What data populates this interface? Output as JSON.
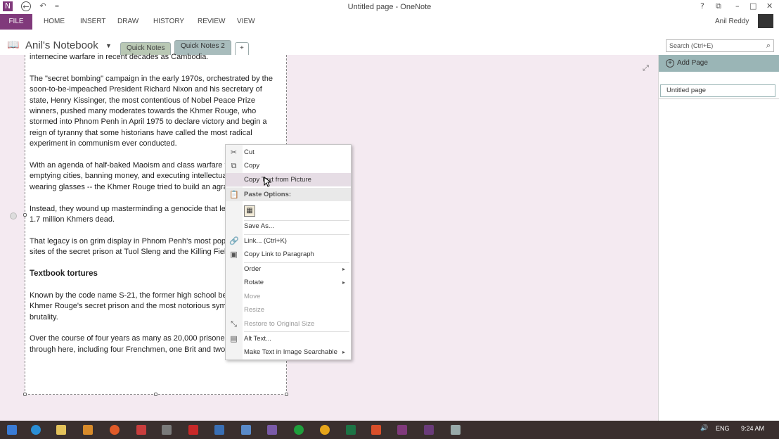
{
  "window": {
    "title": "Untitled page - OneNote",
    "help": "?",
    "ribbon_display": "⧉",
    "minimize": "–",
    "maximize": "□",
    "close": "✕"
  },
  "quick_access": {
    "app": "N",
    "back": "←",
    "undo": "↶",
    "customize": "="
  },
  "ribbon": {
    "tabs": [
      "FILE",
      "HOME",
      "INSERT",
      "DRAW",
      "HISTORY",
      "REVIEW",
      "VIEW"
    ],
    "user": "Anil Reddy"
  },
  "notebook": {
    "name": "Anil's Notebook",
    "sections": [
      "Quick Notes",
      "Quick Notes 2"
    ],
    "add_section": "+"
  },
  "search": {
    "placeholder": "Search (Ctrl+E)"
  },
  "note": {
    "top_line": "internecine warfare in recent decades as Cambodia.",
    "paragraphs": [
      "The \"secret bombing\" campaign in the early 1970s, orchestrated by the soon-to-be-impeached President Richard Nixon and his secretary of state, Henry Kissinger, the most contentious of Nobel Peace Prize winners, pushed many moderates towards the Khmer Rouge, who stormed into Phnom Penh in April 1975 to declare victory and begin a reign of tyranny that some historians have called the most radical experiment in communism ever conducted.",
      "With an agenda of half-baked Maoism and class warfare that included emptying cities, banning money, and executing intellectuals -- or anyone wearing glasses -- the Khmer Rouge tried to build an agrarian utopia.",
      "Instead, they wound up masterminding a genocide that left an estimated 1.7 million Khmers dead.",
      "That legacy is on grim display in Phnom Penh's most popular tourism sites of the secret prison at Tuol Sleng and the Killing Fields."
    ],
    "heading": "Textbook tortures",
    "paragraphs2": [
      "Known by the code name S-21, the former high school became the Khmer Rouge's secret prison and the most notorious symbol of its brutality.",
      "Over the course of four years as many as 20,000 prisoners passed through here, including four Frenchmen, one Brit and two Americans."
    ]
  },
  "context_menu": {
    "items": [
      {
        "label": "Cut",
        "icon": "scissors-icon",
        "glyph": "✂"
      },
      {
        "label": "Copy",
        "icon": "copy-icon",
        "glyph": "⧉"
      },
      {
        "label": "Copy Text from Picture",
        "icon": "",
        "glyph": ""
      },
      {
        "label": "Paste Options:",
        "icon": "paste-icon",
        "glyph": "📋"
      },
      {
        "label": "Save As...",
        "icon": "",
        "glyph": ""
      },
      {
        "label": "Link...  (Ctrl+K)",
        "icon": "link-icon",
        "glyph": "🔗"
      },
      {
        "label": "Copy Link to Paragraph",
        "icon": "link-paragraph-icon",
        "glyph": "▣"
      },
      {
        "label": "Order",
        "icon": "",
        "glyph": ""
      },
      {
        "label": "Rotate",
        "icon": "",
        "glyph": ""
      },
      {
        "label": "Move",
        "icon": "",
        "glyph": ""
      },
      {
        "label": "Resize",
        "icon": "",
        "glyph": ""
      },
      {
        "label": "Restore to Original Size",
        "icon": "restore-size-icon",
        "glyph": "⤡"
      },
      {
        "label": "Alt Text...",
        "icon": "alt-text-icon",
        "glyph": "▤"
      },
      {
        "label": "Make Text in Image Searchable",
        "icon": "",
        "glyph": ""
      }
    ],
    "submenu_arrow": "▸"
  },
  "page_pane": {
    "add_page": "Add Page",
    "add_icon": "+",
    "pages": [
      "Untitled page"
    ]
  },
  "taskbar": {
    "language": "ENG",
    "time": "9:24 AM",
    "volume": "🔊"
  },
  "colors": {
    "onenote_purple": "#80397b",
    "canvas_bg": "#f4eaf1",
    "taskbar": "#3a2f2e",
    "pane_accent": "#9ab5b6"
  }
}
